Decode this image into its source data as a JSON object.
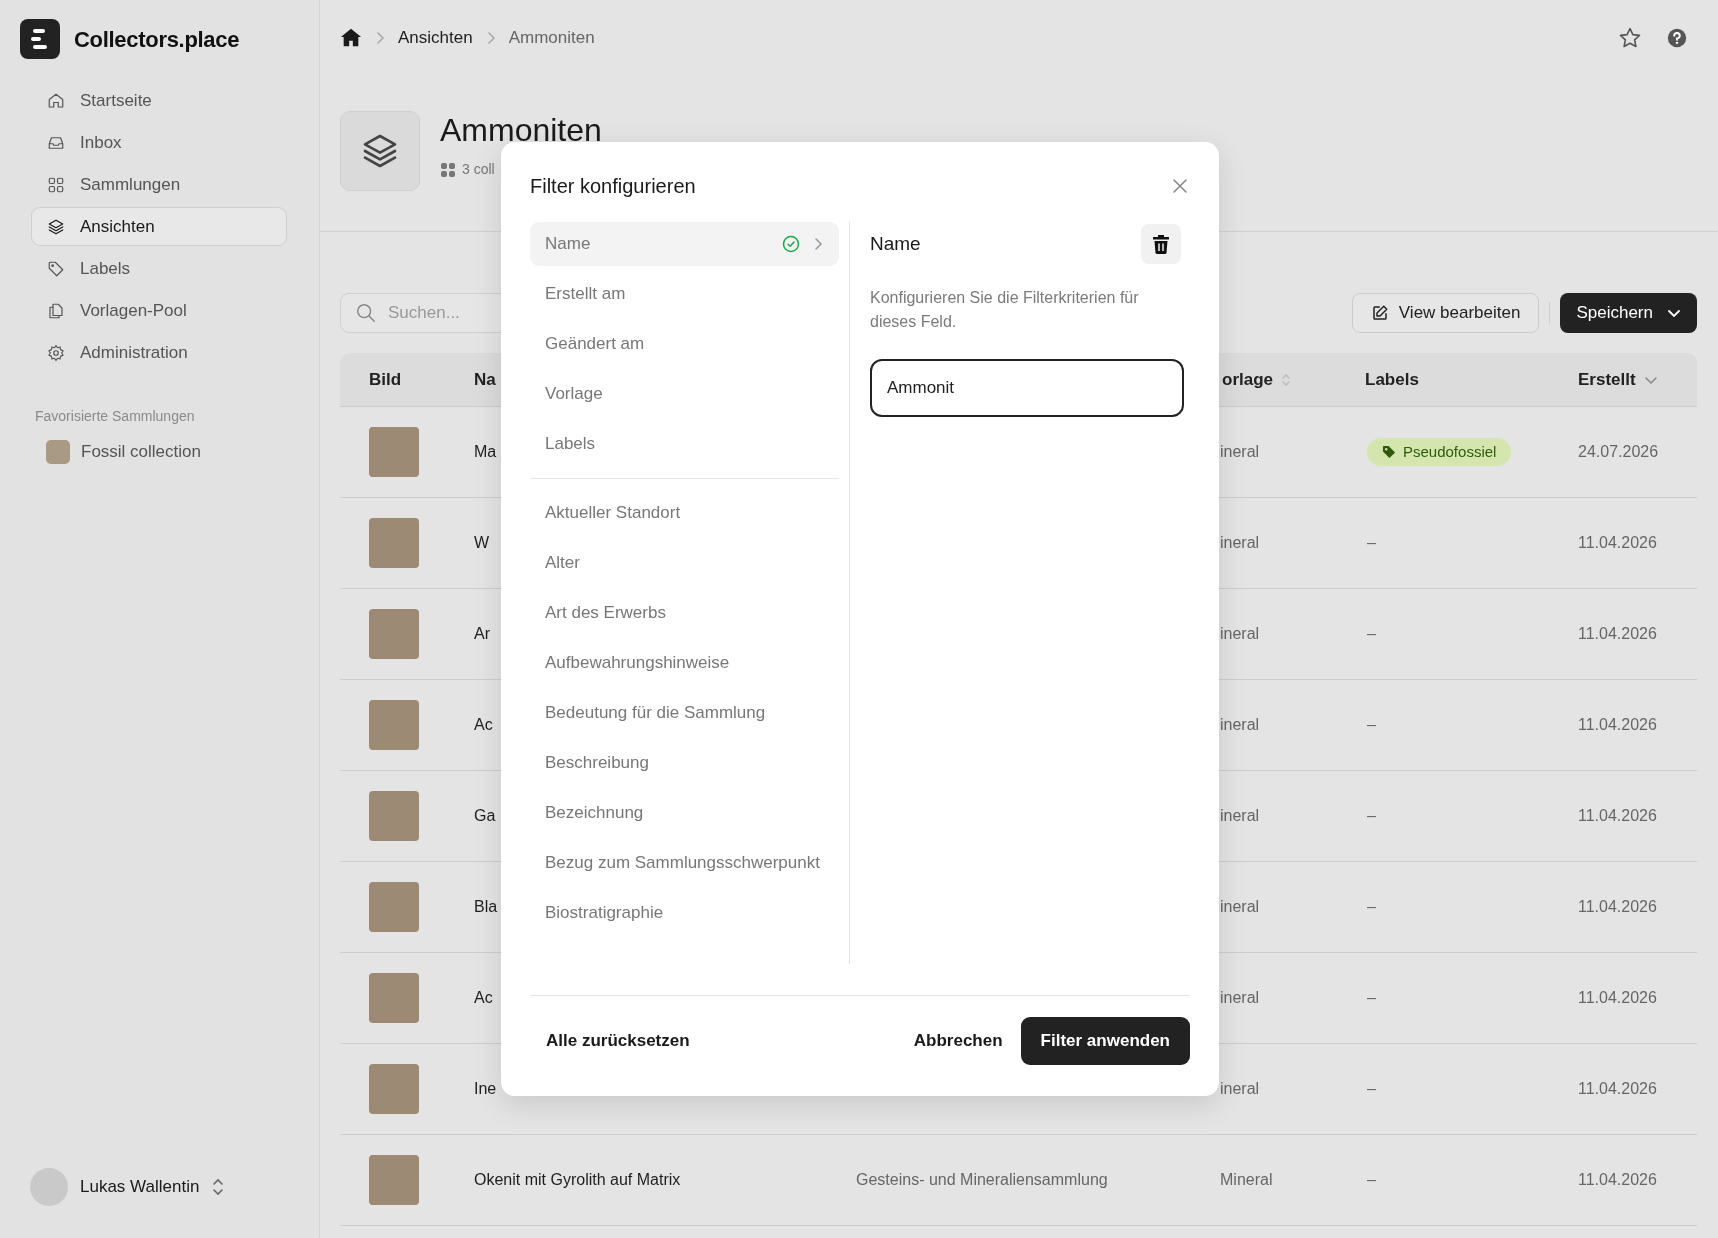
{
  "sidebar": {
    "brand": "Collectors.place",
    "nav": [
      {
        "label": "Startseite",
        "selected": false
      },
      {
        "label": "Inbox",
        "selected": false
      },
      {
        "label": "Sammlungen",
        "selected": false
      },
      {
        "label": "Ansichten",
        "selected": true
      },
      {
        "label": "Labels",
        "selected": false
      },
      {
        "label": "Vorlagen-Pool",
        "selected": false
      },
      {
        "label": "Administration",
        "selected": false
      }
    ],
    "favorites_heading": "Favorisierte Sammlungen",
    "favorites": [
      {
        "label": "Fossil collection"
      }
    ],
    "user": {
      "name": "Lukas Wallentin"
    }
  },
  "breadcrumb": [
    "Ansichten",
    "Ammoniten"
  ],
  "header": {
    "title": "Ammoniten",
    "subtitle": "3 coll"
  },
  "toolbar": {
    "search": {
      "placeholder": "Suchen..."
    },
    "edit_button": "View bearbeiten",
    "save_button": "Speichern"
  },
  "table": {
    "columns": [
      {
        "label": "Bild"
      },
      {
        "label": "Na"
      },
      {
        "label": "orlage",
        "sortable": true,
        "sorted": false
      },
      {
        "label": "Labels"
      },
      {
        "label": "Erstellt",
        "sortable": true,
        "sorted": true
      }
    ],
    "rows": [
      {
        "name": "Ma",
        "template": "ineral",
        "label": {
          "kind": "tag",
          "text": "Pseudofossiel"
        },
        "created": "24.07.2026"
      },
      {
        "name": "W",
        "template": "ineral",
        "label": {
          "kind": "empty",
          "text": "–"
        },
        "created": "11.04.2026"
      },
      {
        "name": "Ar",
        "template": "ineral",
        "label": {
          "kind": "empty",
          "text": "–"
        },
        "created": "11.04.2026"
      },
      {
        "name": "Ac",
        "template": "ineral",
        "label": {
          "kind": "empty",
          "text": "–"
        },
        "created": "11.04.2026"
      },
      {
        "name": "Ga",
        "template": "ineral",
        "label": {
          "kind": "empty",
          "text": "–"
        },
        "created": "11.04.2026"
      },
      {
        "name": "Bla",
        "template": "ineral",
        "label": {
          "kind": "empty",
          "text": "–"
        },
        "created": "11.04.2026"
      },
      {
        "name": "Ac",
        "template": "ineral",
        "label": {
          "kind": "empty",
          "text": "–"
        },
        "created": "11.04.2026"
      },
      {
        "name": "Ine",
        "template": "ineral",
        "label": {
          "kind": "empty",
          "text": "–"
        },
        "created": "11.04.2026"
      },
      {
        "name": "Okenit mit Gyrolith auf Matrix",
        "collection": "Gesteins- und Mineraliensammlung",
        "template": "Mineral",
        "label": {
          "kind": "empty",
          "text": "–"
        },
        "created": "11.04.2026"
      }
    ]
  },
  "modal": {
    "title": "Filter konfigurieren",
    "field_groups": [
      {
        "items": [
          {
            "label": "Name",
            "selected": true,
            "configured": true
          },
          {
            "label": "Erstellt am",
            "selected": false,
            "configured": false
          },
          {
            "label": "Geändert am",
            "selected": false,
            "configured": false
          },
          {
            "label": "Vorlage",
            "selected": false,
            "configured": false
          },
          {
            "label": "Labels",
            "selected": false,
            "configured": false
          }
        ]
      },
      {
        "items": [
          {
            "label": "Aktueller Standort",
            "selected": false,
            "configured": false
          },
          {
            "label": "Alter",
            "selected": false,
            "configured": false
          },
          {
            "label": "Art des Erwerbs",
            "selected": false,
            "configured": false
          },
          {
            "label": "Aufbewahrungshinweise",
            "selected": false,
            "configured": false
          },
          {
            "label": "Bedeutung für die Sammlung",
            "selected": false,
            "configured": false
          },
          {
            "label": "Beschreibung",
            "selected": false,
            "configured": false
          },
          {
            "label": "Bezeichnung",
            "selected": false,
            "configured": false
          },
          {
            "label": "Bezug zum Sammlungsschwerpunkt",
            "selected": false,
            "configured": false
          },
          {
            "label": "Biostratigraphie",
            "selected": false,
            "configured": false
          }
        ]
      }
    ],
    "detail": {
      "title": "Name",
      "description": "Konfigurieren Sie die Filterkriterien für dieses Feld.",
      "value": "Ammonit"
    },
    "reset": "Alle zurücksetzen",
    "cancel": "Abbrechen",
    "apply": "Filter anwenden"
  }
}
